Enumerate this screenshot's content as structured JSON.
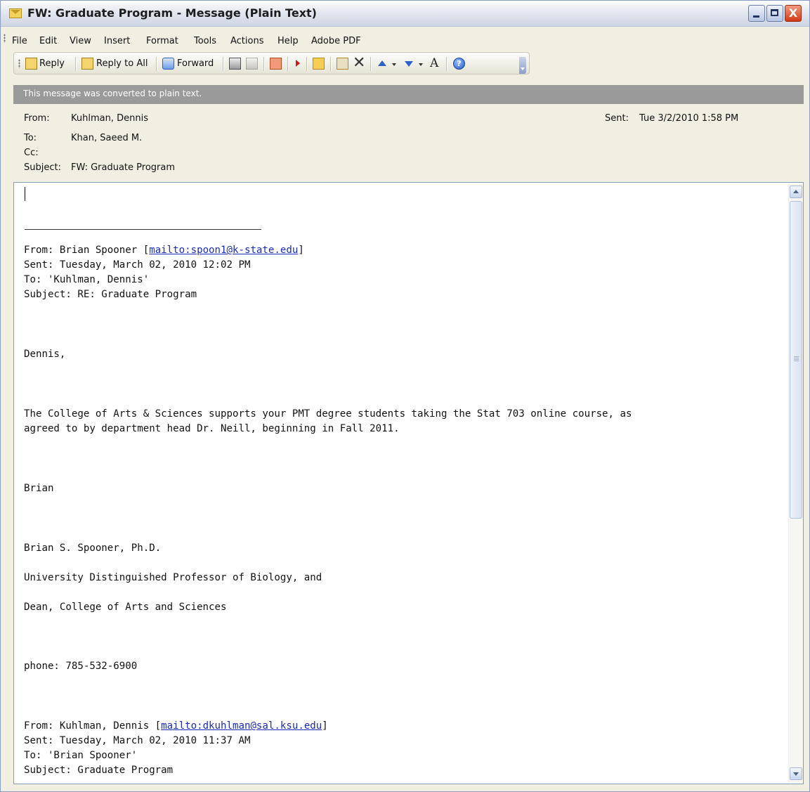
{
  "window": {
    "title": "FW: Graduate Program - Message (Plain Text)",
    "close_glyph": "X"
  },
  "menu": [
    "File",
    "Edit",
    "View",
    "Insert",
    "Format",
    "Tools",
    "Actions",
    "Help",
    "Adobe PDF"
  ],
  "toolbar": {
    "reply": "Reply",
    "reply_all": "Reply to All",
    "forward": "Forward",
    "font_glyph": "A",
    "help_glyph": "?",
    "delete_glyph": "✕",
    "icons": [
      "reply-icon",
      "reply-all-icon",
      "forward-icon",
      "print-icon",
      "copy-icon",
      "move-to-folder-icon",
      "flag-icon",
      "open-folder-icon",
      "move-icon",
      "delete-icon",
      "previous-item-icon",
      "next-item-icon",
      "font-size-icon",
      "help-icon"
    ]
  },
  "infobar": "This message was converted to plain text.",
  "header": {
    "from_label": "From:",
    "from": "Kuhlman, Dennis",
    "to_label": "To:",
    "to": "Khan, Saeed M.",
    "cc_label": "Cc:",
    "cc": "",
    "subject_label": "Subject:",
    "subject": "FW: Graduate Program",
    "sent_label": "Sent:",
    "sent": "Tue 3/2/2010 1:58 PM"
  },
  "body": {
    "fwd1_from_prefix": "From: Brian Spooner [",
    "fwd1_link": "mailto:spoon1@k-state.edu",
    "fwd1_sent": "Sent: Tuesday, March 02, 2010 12:02 PM",
    "fwd1_to": "To: 'Kuhlman, Dennis'",
    "fwd1_subject": "Subject: RE: Graduate Program",
    "greeting": "Dennis,",
    "para1": "The College of Arts & Sciences supports your PMT degree students taking the Stat 703 online course, as",
    "para2": "agreed to by department head Dr. Neill, beginning in Fall 2011.",
    "sign_name": "Brian",
    "sig1": "Brian S. Spooner, Ph.D.",
    "sig2": "University Distinguished Professor of Biology, and",
    "sig3": "Dean, College of Arts and Sciences",
    "phone": "phone: 785-532-6900",
    "fwd2_from_prefix": "From: Kuhlman, Dennis [",
    "fwd2_link": "mailto:dkuhlman@sal.ksu.edu",
    "fwd2_sent": "Sent: Tuesday, March 02, 2010 11:37 AM",
    "fwd2_to": "To: 'Brian Spooner'",
    "fwd2_subject": "Subject: Graduate Program",
    "bracket_close": "]"
  }
}
